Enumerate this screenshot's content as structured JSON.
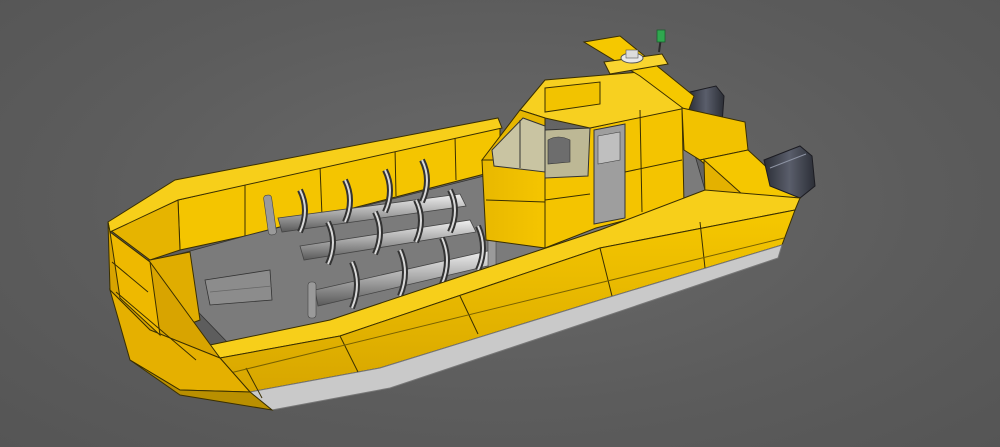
{
  "viewport": {
    "background": "#5e5e5e"
  },
  "model": {
    "hull_color": "#f2c200",
    "hull_shade": "#d9a800",
    "hull_dark": "#b98f00",
    "edge_color": "#3a2f00",
    "deck_color": "#7a7a7a",
    "waterline_color": "#c9c9c9",
    "glass_color": "#c8c3a0",
    "seat_metal": "#b8b8b8",
    "engine_color": "#3c3f4a",
    "mast_light": "#2fa84f",
    "seat_rows": 3,
    "seats_per_row": 4,
    "engines": 2
  }
}
